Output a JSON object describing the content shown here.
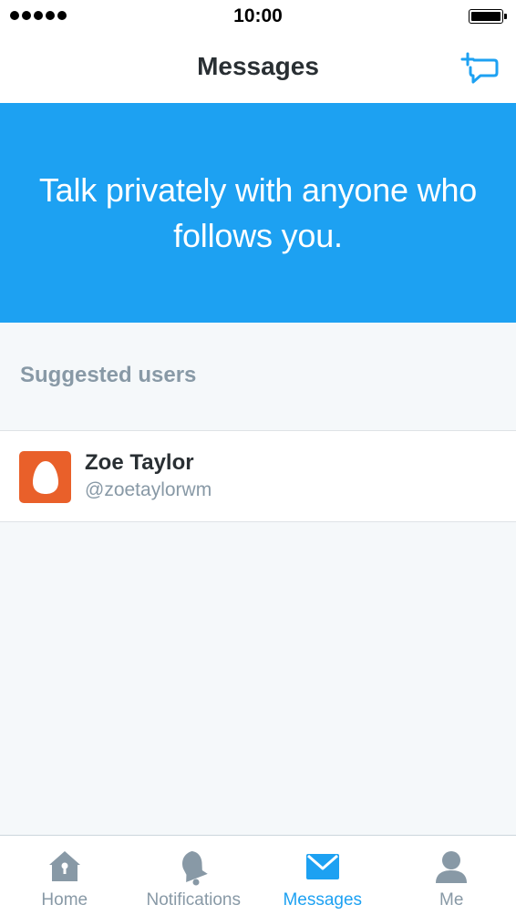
{
  "status_bar": {
    "time": "10:00"
  },
  "nav": {
    "title": "Messages",
    "compose_icon": "new-message-icon"
  },
  "banner": {
    "text": "Talk privately with anyone who follows you."
  },
  "suggested": {
    "header": "Suggested users",
    "users": [
      {
        "name": "Zoe Taylor",
        "handle": "@zoetaylorwm",
        "avatar_icon": "egg-avatar-icon",
        "avatar_color": "#e9602a"
      }
    ]
  },
  "tabs": [
    {
      "label": "Home",
      "icon": "home-icon",
      "active": false
    },
    {
      "label": "Notifications",
      "icon": "bell-icon",
      "active": false
    },
    {
      "label": "Messages",
      "icon": "envelope-icon",
      "active": true
    },
    {
      "label": "Me",
      "icon": "person-icon",
      "active": false
    }
  ],
  "colors": {
    "accent": "#1da1f2",
    "inactive": "#8899a6",
    "background": "#f5f8fa"
  }
}
